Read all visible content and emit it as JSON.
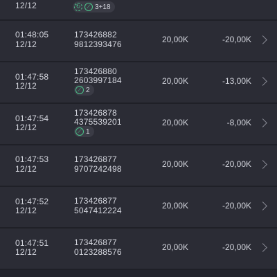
{
  "rows": [
    {
      "time": "",
      "date": "12/12",
      "id1": "",
      "id2": "",
      "amount": "",
      "diff": "",
      "pill": "3+18",
      "pill_icons": [
        "refresh-icon",
        "pin-icon"
      ]
    },
    {
      "time": "01:48:05",
      "date": "12/12",
      "id1": "173426882",
      "id2": "9812393476",
      "amount": "20,00K",
      "diff": "-20,00K"
    },
    {
      "time": "01:47:58",
      "date": "12/12",
      "id1": "173426880",
      "id2": "2603997184",
      "amount": "20,00K",
      "diff": "-13,00K",
      "pill": "2",
      "pill_icons": [
        "pin-icon"
      ]
    },
    {
      "time": "01:47:54",
      "date": "12/12",
      "id1": "173426878",
      "id2": "4375539201",
      "amount": "20,00K",
      "diff": "-8,00K",
      "pill": "1",
      "pill_icons": [
        "pin-icon"
      ]
    },
    {
      "time": "01:47:53",
      "date": "12/12",
      "id1": "173426877",
      "id2": "9707242498",
      "amount": "20,00K",
      "diff": "-20,00K"
    },
    {
      "time": "01:47:52",
      "date": "12/12",
      "id1": "173426877",
      "id2": "5047412224",
      "amount": "20,00K",
      "diff": "-20,00K"
    },
    {
      "time": "01:47:51",
      "date": "12/12",
      "id1": "173426877",
      "id2": "0123288576",
      "amount": "20,00K",
      "diff": "-20,00K"
    }
  ],
  "colors": {
    "background": "#24252d",
    "row": "#2b2c35",
    "accent_green": "#4cc38a",
    "text": "#d4d6de"
  }
}
